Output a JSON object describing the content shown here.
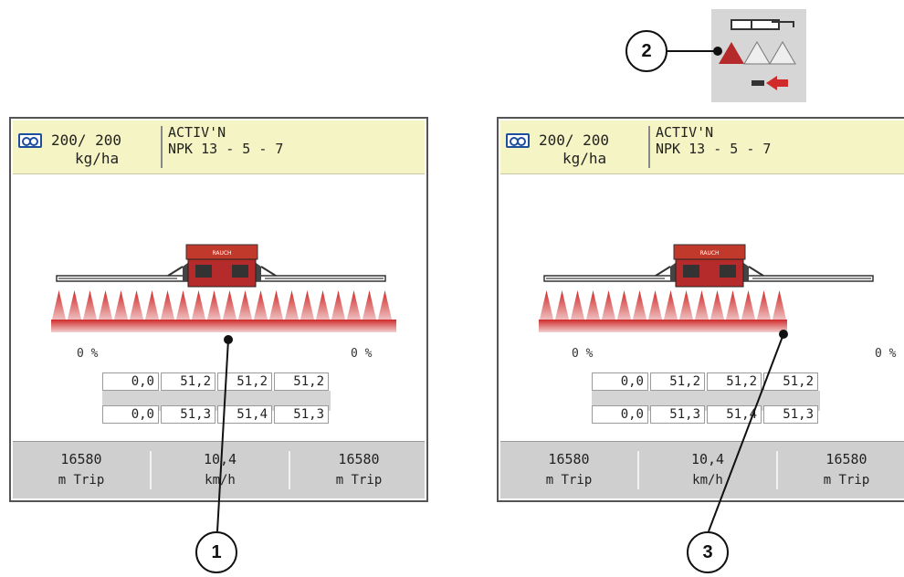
{
  "screens": [
    {
      "id": "left",
      "header": {
        "rate": "200/ 200",
        "unit": "kg/ha",
        "name": "ACTIV'N",
        "fertilizer": "NPK 13 - 5 - 7"
      },
      "left_pct": "0 %",
      "right_pct": "0 %",
      "row1": [
        "0,0",
        "51,2",
        "51,2",
        "51,2"
      ],
      "row2": [
        "0,0",
        "51,3",
        "51,4",
        "51,3"
      ],
      "footer": [
        {
          "value": "16580",
          "unit": "m Trip"
        },
        {
          "value": "10,4",
          "unit": "km/h"
        },
        {
          "value": "16580",
          "unit": "m Trip"
        }
      ],
      "brand": "RAUCH"
    },
    {
      "id": "right",
      "header": {
        "rate": "200/ 200",
        "unit": "kg/ha",
        "name": "ACTIV'N",
        "fertilizer": "NPK 13 - 5 - 7"
      },
      "left_pct": "0 %",
      "right_pct": "0 %",
      "row1": [
        "0,0",
        "51,2",
        "51,2",
        "51,2"
      ],
      "row2": [
        "0,0",
        "51,3",
        "51,4",
        "51,3"
      ],
      "footer": [
        {
          "value": "16580",
          "unit": "m Trip"
        },
        {
          "value": "10,4",
          "unit": "km/h"
        },
        {
          "value": "16580",
          "unit": "m Trip"
        }
      ],
      "brand": "RAUCH"
    }
  ],
  "callouts": [
    "1",
    "2",
    "3"
  ],
  "colors": {
    "header_bg": "#f5f4c4",
    "spray_red": "#c0392b",
    "footer_bg": "#cfcfcf",
    "icon_blue": "#1e4f9e"
  },
  "icons": [
    "rate-icon",
    "section-reduce-icon",
    "spreader-icon"
  ]
}
